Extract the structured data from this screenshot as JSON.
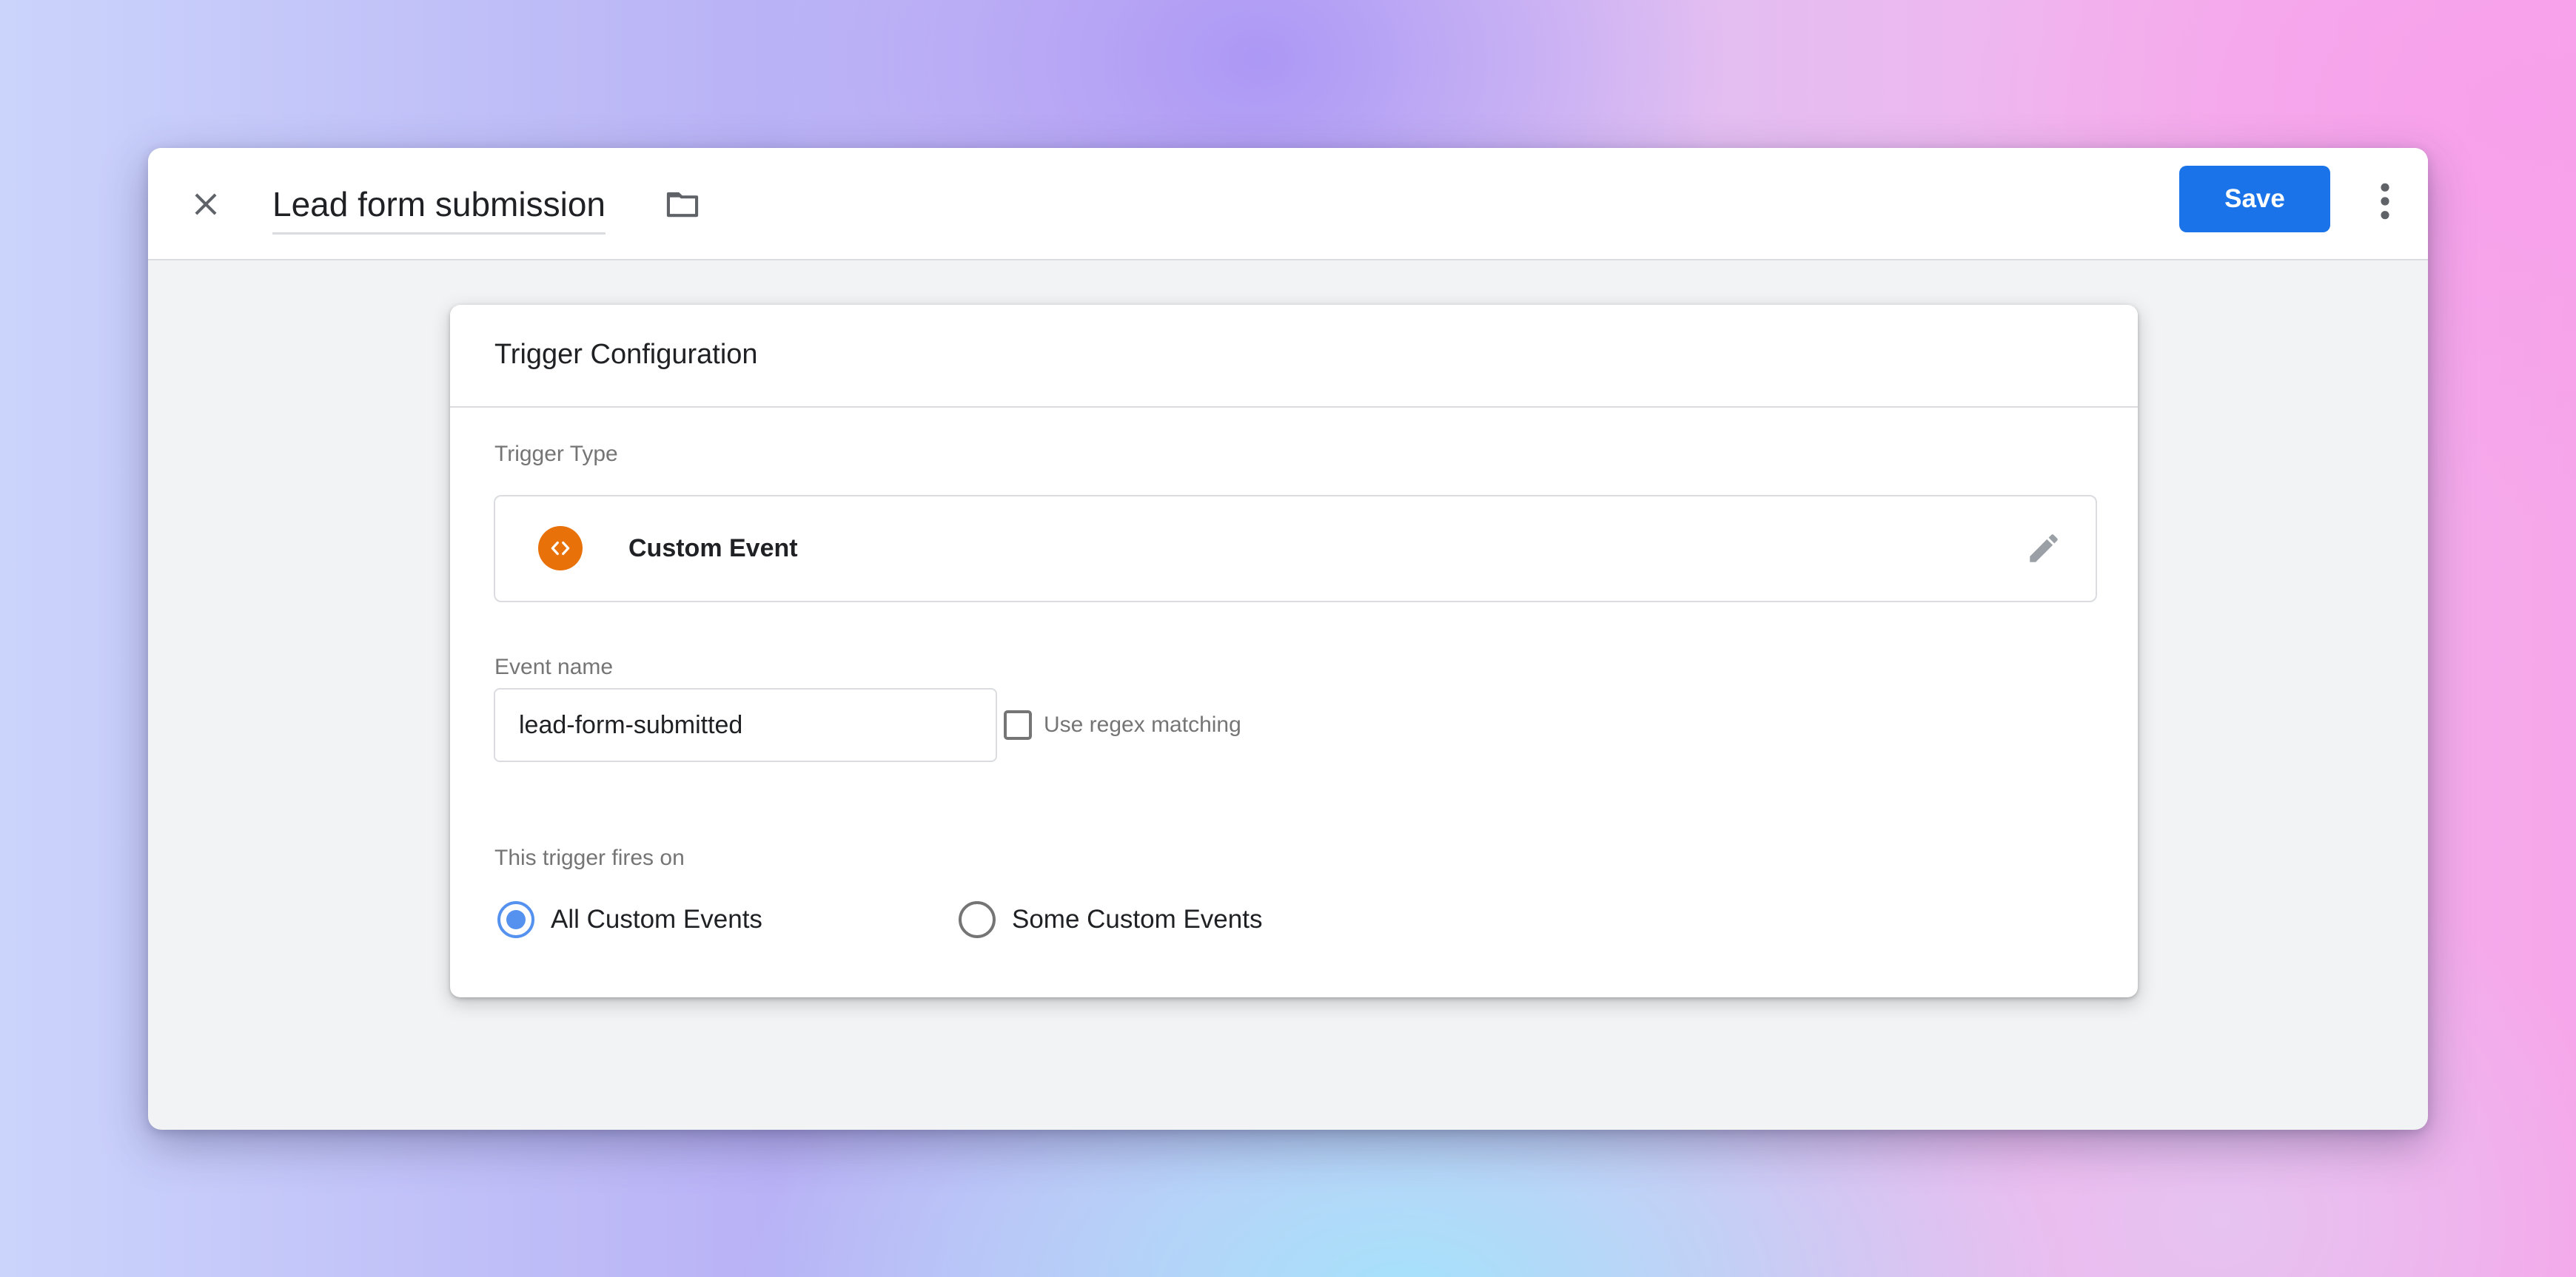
{
  "header": {
    "title": "Lead form submission",
    "close_icon": "close-icon",
    "folder_icon": "folder-icon",
    "save_label": "Save",
    "more_icon": "more-vertical-icon"
  },
  "card": {
    "title": "Trigger Configuration",
    "trigger_type": {
      "label": "Trigger Type",
      "name": "Custom Event",
      "icon": "code-brackets-icon",
      "icon_color": "#e8710a",
      "edit_icon": "pencil-icon"
    },
    "event_name": {
      "label": "Event name",
      "value": "lead-form-submitted",
      "regex_label": "Use regex matching",
      "regex_checked": false
    },
    "fires_on": {
      "label": "This trigger fires on",
      "options": [
        {
          "label": "All Custom Events",
          "selected": true
        },
        {
          "label": "Some Custom Events",
          "selected": false
        }
      ]
    }
  },
  "colors": {
    "accent": "#1a73e8",
    "radio_selected": "#5592f0",
    "window_bg": "#f1f3f4"
  }
}
